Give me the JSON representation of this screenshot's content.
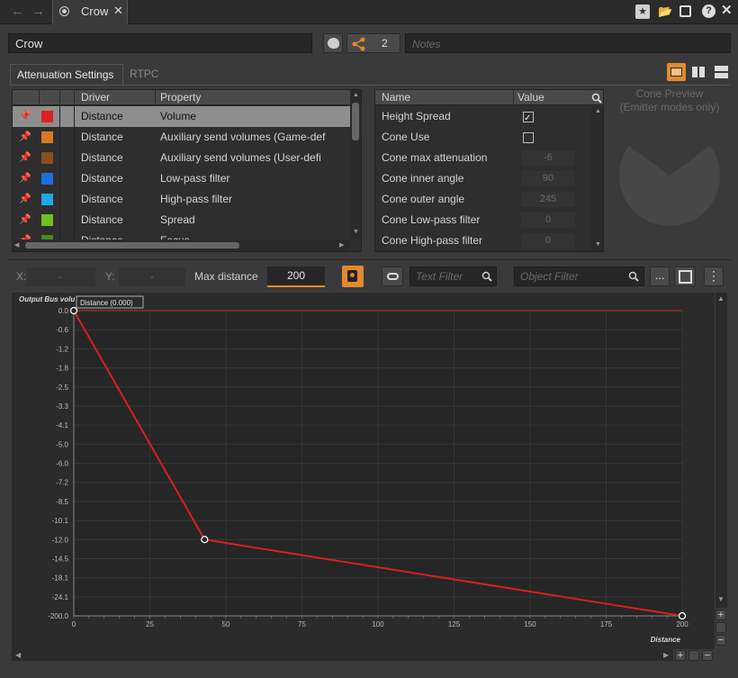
{
  "window": {
    "tab_title": "Crow"
  },
  "object_bar": {
    "name_value": "Crow",
    "share_count": "2",
    "notes_placeholder": "Notes"
  },
  "tabs": [
    {
      "label": "Attenuation Settings",
      "active": true
    },
    {
      "label": "RTPC",
      "active": false
    }
  ],
  "curve_table": {
    "headers": {
      "driver": "Driver",
      "property": "Property"
    },
    "rows": [
      {
        "driver": "Distance",
        "property": "Volume",
        "color": "#e02020",
        "selected": true
      },
      {
        "driver": "Distance",
        "property": "Auxiliary send volumes (Game-def",
        "color": "#d97a20"
      },
      {
        "driver": "Distance",
        "property": "Auxiliary send volumes (User-defi",
        "color": "#8a4f1c"
      },
      {
        "driver": "Distance",
        "property": "Low-pass filter",
        "color": "#1a6fe0"
      },
      {
        "driver": "Distance",
        "property": "High-pass filter",
        "color": "#20a8e8"
      },
      {
        "driver": "Distance",
        "property": "Spread",
        "color": "#6cc21a"
      },
      {
        "driver": "Distance",
        "property": "Focus",
        "color": "#4a8a1a"
      }
    ]
  },
  "properties": {
    "headers": {
      "name": "Name",
      "value": "Value"
    },
    "rows": [
      {
        "name": "Height Spread",
        "type": "checkbox",
        "checked": true
      },
      {
        "name": "Cone Use",
        "type": "checkbox",
        "checked": false
      },
      {
        "name": "Cone max attenuation",
        "type": "slider",
        "value": "-6"
      },
      {
        "name": "Cone inner angle",
        "type": "slider",
        "value": "90"
      },
      {
        "name": "Cone outer angle",
        "type": "slider",
        "value": "245"
      },
      {
        "name": "Cone Low-pass filter",
        "type": "slider",
        "value": "0"
      },
      {
        "name": "Cone High-pass filter",
        "type": "slider",
        "value": "0"
      }
    ]
  },
  "cone_preview": {
    "title": "Cone Preview",
    "subtitle": "(Emitter modes only)"
  },
  "toolbar": {
    "x_label": "X:",
    "x_value": "-",
    "y_label": "Y:",
    "y_value": "-",
    "max_distance_label": "Max distance",
    "max_distance_value": "200",
    "text_filter_placeholder": "Text Filter",
    "object_filter_placeholder": "Object Filter",
    "more_label": "..."
  },
  "graph_ui": {
    "tooltip": "Distance (0.000)"
  },
  "chart_data": {
    "type": "line",
    "ylabel": "Output Bus volu",
    "xlabel": "Distance",
    "xlim": [
      0,
      200
    ],
    "x_ticks": [
      "0",
      "25",
      "50",
      "75",
      "100",
      "125",
      "150",
      "175",
      "200"
    ],
    "y_ticks": [
      "0.0",
      "-0.6",
      "-1.2",
      "-1.8",
      "-2.5",
      "-3.3",
      "-4.1",
      "-5.0",
      "-6.0",
      "-7.2",
      "-8.5",
      "-10.1",
      "-12.0",
      "-14.5",
      "-18.1",
      "-24.1",
      "-200.0"
    ],
    "series": [
      {
        "color": "#d82020",
        "x": [
          0,
          43,
          200
        ],
        "y": [
          0.0,
          -12.0,
          -200.0
        ]
      }
    ],
    "reference_line_y": 0.0,
    "grid": true
  }
}
